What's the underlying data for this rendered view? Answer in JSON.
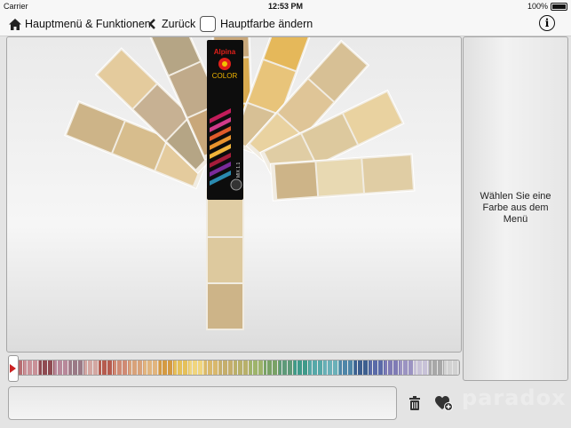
{
  "status_bar": {
    "carrier": "Carrier",
    "time": "12:53 PM",
    "battery": "100%"
  },
  "toolbar": {
    "main_menu_label": "Hauptmenü & Funktionen",
    "back_label": "Zurück",
    "change_main_color_label": "Hauptfarbe ändern"
  },
  "fan_deck": {
    "brand_top": "Alpina",
    "brand_bottom": "COLOR",
    "deck_code": "MIX 1.1",
    "colors": [
      "#cdb488",
      "#d7bd8d",
      "#e4cb9d",
      "#c7b193",
      "#b5a585",
      "#c0aa8a",
      "#c8a77a",
      "#d9aa4f",
      "#e5b85a",
      "#e8c47a",
      "#d7c095",
      "#dfc597",
      "#e9d2a0",
      "#ddc99e",
      "#e0cda4",
      "#e8d9b2"
    ]
  },
  "page_dots": {
    "count": 2,
    "active": 0
  },
  "side_panel": {
    "message": "Wählen Sie eine Farbe aus dem Menü"
  },
  "color_strip": {
    "colors": [
      "#b86e72",
      "#c99198",
      "#8f4b52",
      "#b8889a",
      "#9a7a86",
      "#d3a7a2",
      "#b65c4f",
      "#cf8a74",
      "#d8a27a",
      "#e1b57e",
      "#d49a42",
      "#e5c05a",
      "#f0d57e",
      "#d9b86c",
      "#c5ae6c",
      "#b8b06a",
      "#9eb46b",
      "#79a266",
      "#5e9a79",
      "#3f9a8a",
      "#56a8a8",
      "#6ab0b8",
      "#4f86a8",
      "#3d5f8f",
      "#5a6aa8",
      "#7f7bb5",
      "#9b93c2",
      "#c8c2d8",
      "#a8a8a8",
      "#d2d2d2"
    ]
  },
  "actions": {
    "trash": "trash-icon",
    "favorite": "heart-plus-icon"
  },
  "watermark": "paradox"
}
